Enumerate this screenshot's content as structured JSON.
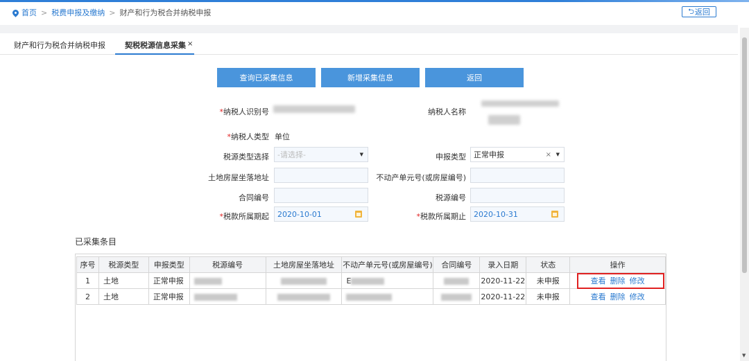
{
  "breadcrumb": {
    "home": "首页",
    "level2": "税费申报及缴纳",
    "current": "财产和行为税合并纳税申报"
  },
  "back_button": "返回",
  "tabs": [
    {
      "label": "财产和行为税合并纳税申报"
    },
    {
      "label": "契税税源信息采集",
      "close": "×"
    }
  ],
  "actions": {
    "query": "查询已采集信息",
    "add": "新增采集信息",
    "back": "返回"
  },
  "form": {
    "taxpayer_id_label": "纳税人识别号",
    "taxpayer_name_label": "纳税人名称",
    "taxpayer_type_label": "纳税人类型",
    "taxpayer_type_value": "单位",
    "source_type_label": "税源类型选择",
    "source_type_placeholder": "-请选择-",
    "declare_type_label": "申报类型",
    "declare_type_value": "正常申报",
    "clear": "×",
    "address_label": "土地房屋坐落地址",
    "property_no_label": "不动产单元号(或房屋编号)",
    "contract_no_label": "合同编号",
    "source_no_label": "税源编号",
    "period_start_label": "税款所属期起",
    "period_start_value": "2020-10-01",
    "period_end_label": "税款所属期止",
    "period_end_value": "2020-10-31",
    "required_mark": "*"
  },
  "collected": {
    "title": "已采集条目",
    "headers": [
      "序号",
      "税源类型",
      "申报类型",
      "税源编号",
      "土地房屋坐落地址",
      "不动产单元号(或房屋编号)",
      "合同编号",
      "录入日期",
      "状态",
      "操作"
    ],
    "rows": [
      {
        "no": "1",
        "source_type": "土地",
        "declare_type": "正常申报",
        "property_prefix": "E",
        "date": "2020-11-22",
        "status": "未申报"
      },
      {
        "no": "2",
        "source_type": "土地",
        "declare_type": "正常申报",
        "property_prefix": "",
        "date": "2020-11-22",
        "status": "未申报"
      }
    ],
    "ops": {
      "view": "查看",
      "delete": "删除",
      "edit": "修改"
    }
  },
  "colors": {
    "accent": "#2a7ad0",
    "button": "#4a95dc",
    "required": "#e02020"
  }
}
